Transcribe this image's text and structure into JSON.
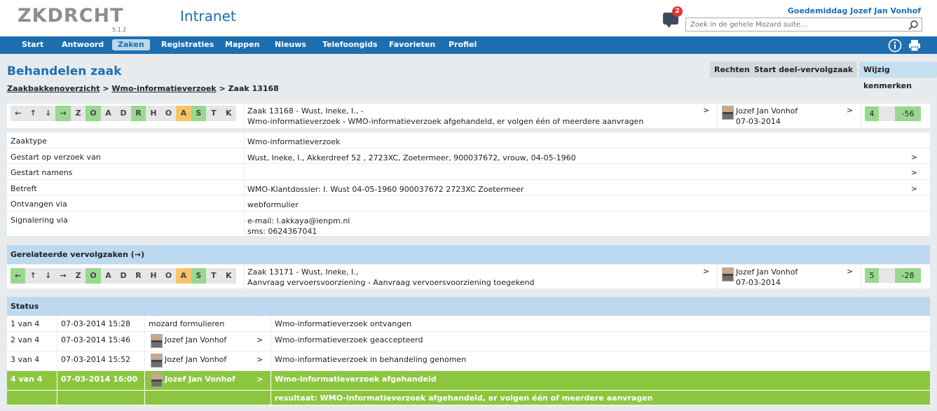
{
  "header": {
    "logo": "ZKDRCHT",
    "version": "5.1.2",
    "app_title": "Intranet",
    "notification_count": "2",
    "greeting": "Goedemiddag Jozef Jan Vonhof",
    "search_placeholder": "Zoek in de gehele Mozard suite..."
  },
  "nav": {
    "items": [
      "Start",
      "Antwoord",
      "Zaken",
      "Registraties",
      "Mappen",
      "Nieuws",
      "Telefoongids",
      "Favorieten",
      "Profiel"
    ],
    "active": "Zaken",
    "icons": [
      "info-icon",
      "print-icon"
    ]
  },
  "page": {
    "title": "Behandelen zaak",
    "buttons": {
      "rechten": "Rechten",
      "start_deel": "Start deel-vervolgzaak",
      "wijzig": "Wijzig kenmerken"
    },
    "breadcrumb": {
      "link1": "Zaakbakkenoverzicht",
      "sep1": ">",
      "link2": "Wmo-informatieverzoek",
      "sep2": ">",
      "current": "Zaak 13168"
    }
  },
  "zaak_nav": {
    "buttons": [
      "←",
      "↑",
      "↓",
      "→",
      "Z",
      "O",
      "A",
      "D",
      "R",
      "H",
      "O",
      "A",
      "S",
      "T",
      "K"
    ],
    "green": [
      3,
      5,
      8,
      12
    ],
    "orange": [
      11
    ]
  },
  "current_zaak": {
    "line1": "Zaak 13168 - Wust, Ineke, I., -",
    "line2": "Wmo-informatieverzoek - WMO-informatieverzoek afgehandeld, er volgen één of meerdere aanvragen",
    "chevron": ">",
    "person": "Jozef Jan Vonhof",
    "date": "07-03-2014",
    "person_chevron": ">",
    "count": "4",
    "days": "-56"
  },
  "details": [
    {
      "label": "Zaaktype",
      "value": "Wmo-informatieverzoek",
      "value2": "",
      "chevron": ""
    },
    {
      "label": "Gestart op verzoek van",
      "value": "Wust, Ineke, I., Akkerdreef 52 , 2723XC, Zoetermeer, 900037672, vrouw, 04-05-1960",
      "value2": "",
      "chevron": ">"
    },
    {
      "label": "Gestart namens",
      "value": "",
      "value2": "",
      "chevron": ">"
    },
    {
      "label": "Betreft",
      "value": "WMO-Klantdossier: I. Wust 04-05-1960 900037672 2723XC Zoetermeer",
      "value2": "",
      "chevron": ">"
    },
    {
      "label": "Ontvangen via",
      "value": "webformulier",
      "value2": "",
      "chevron": ""
    },
    {
      "label": "Signalering via",
      "value": "e-mail: l.akkaya@ienpm.nl",
      "value2": "sms: 0624367041",
      "chevron": ""
    }
  ],
  "related": {
    "header": "Gerelateerde vervolgzaken (→)",
    "nav_buttons": [
      "←",
      "↑",
      "↓",
      "→",
      "Z",
      "O",
      "A",
      "D",
      "R",
      "H",
      "O",
      "A",
      "S",
      "T",
      "K"
    ],
    "green": [
      0,
      5,
      12
    ],
    "orange": [
      11
    ],
    "line1": "Zaak 13171 - Wust, Ineke, I.,",
    "line2": "Aanvraag vervoersvoorziening - Aanvraag vervoersvoorziening toegekend",
    "chevron": ">",
    "person": "Jozef Jan Vonhof",
    "date": "07-03-2014",
    "person_chevron": ">",
    "count": "5",
    "days": "-28"
  },
  "status": {
    "header": "Status",
    "rows": [
      {
        "step": "1 van 4",
        "datetime": "07-03-2014 15:28",
        "who": "mozard formulieren",
        "has_avatar": false,
        "chevron": "",
        "desc": "Wmo-informatieverzoek ontvangen"
      },
      {
        "step": "2 van 4",
        "datetime": "07-03-2014 15:46",
        "who": "Jozef Jan Vonhof",
        "has_avatar": true,
        "chevron": ">",
        "desc": "Wmo-informatieverzoek geaccepteerd"
      },
      {
        "step": "3 van 4",
        "datetime": "07-03-2014 15:52",
        "who": "Jozef Jan Vonhof",
        "has_avatar": true,
        "chevron": ">",
        "desc": "Wmo-informatieverzoek in behandeling genomen"
      },
      {
        "step": "4 van 4",
        "datetime": "07-03-2014 16:00",
        "who": "Jozef Jan Vonhof",
        "has_avatar": true,
        "chevron": ">",
        "desc": "Wmo-informatieverzoek afgehandeld"
      }
    ],
    "result": "resultaat: WMO-informatieverzoek afgehandeld, er volgen één of meerdere aanvragen"
  },
  "colors": {
    "brand_blue": "#1e6fb0",
    "nav_green": "#99d98f",
    "nav_orange": "#f6c46a",
    "done_green": "#8cc63f",
    "section_blue": "#bcd9f0"
  }
}
